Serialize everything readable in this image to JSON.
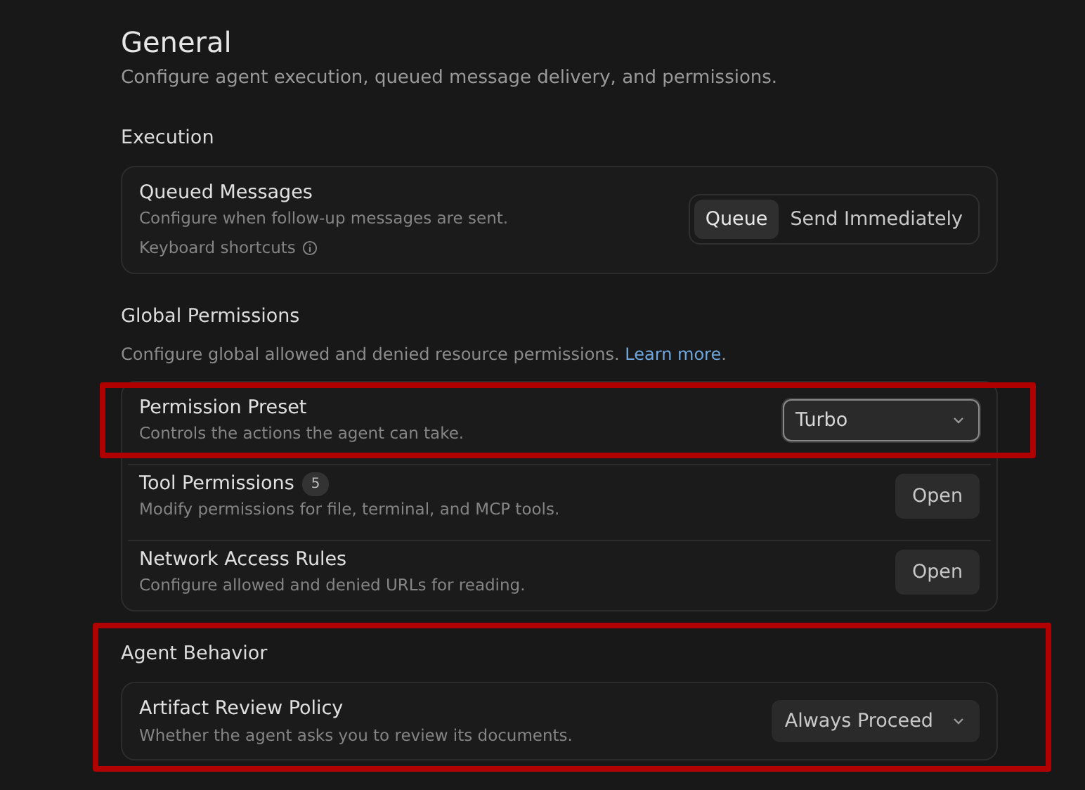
{
  "page": {
    "title": "General",
    "description": "Configure agent execution, queued message delivery, and permissions."
  },
  "sections": [
    {
      "title": "Execution",
      "highlighted": false,
      "rows": [
        {
          "title": "Queued Messages",
          "description": "Configure when follow-up messages are sent.",
          "hint": "Keyboard shortcuts",
          "highlighted": false,
          "control": {
            "kind": "segmented",
            "options": [
              {
                "label": "Queue",
                "selected": true
              },
              {
                "label": "Send Immediately",
                "selected": false
              }
            ]
          }
        }
      ]
    },
    {
      "title": "Global Permissions",
      "description": "Configure global allowed and denied resource permissions. ",
      "link": "Learn more",
      "after_link": ".",
      "highlighted": false,
      "rows": [
        {
          "title": "Permission Preset",
          "description": "Controls the actions the agent can take.",
          "highlighted": true,
          "control": {
            "kind": "select",
            "value": "Turbo",
            "focused": true
          }
        },
        {
          "title": "Tool Permissions",
          "badge": "5",
          "description": "Modify permissions for file, terminal, and MCP tools.",
          "highlighted": false,
          "control": {
            "kind": "button",
            "label": "Open"
          }
        },
        {
          "title": "Network Access Rules",
          "description": "Configure allowed and denied URLs for reading.",
          "highlighted": false,
          "control": {
            "kind": "button",
            "label": "Open"
          }
        }
      ]
    },
    {
      "title": "Agent Behavior",
      "highlighted": true,
      "rows": [
        {
          "title": "Artifact Review Policy",
          "description": "Whether the agent asks you to review its documents.",
          "highlighted": false,
          "control": {
            "kind": "select",
            "value": "Always Proceed",
            "focused": false
          }
        }
      ]
    }
  ]
}
